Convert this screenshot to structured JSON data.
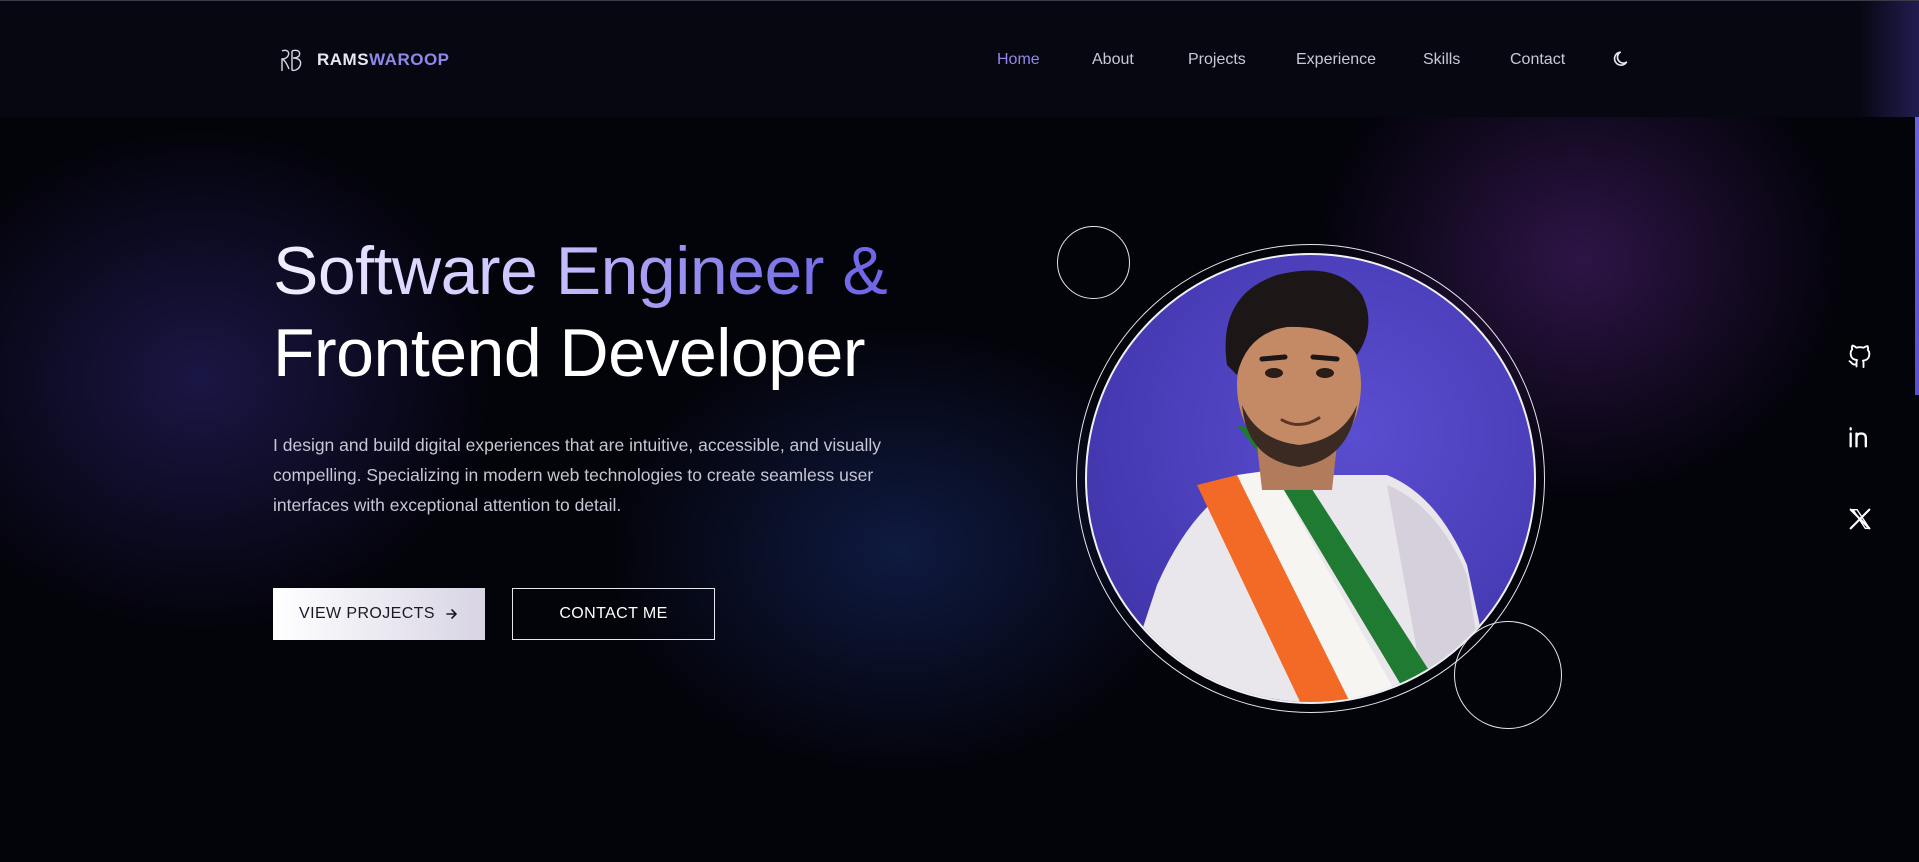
{
  "header": {
    "logo_part1": "RAMS",
    "logo_part2": "WAROOP",
    "nav": [
      {
        "label": "Home",
        "active": true
      },
      {
        "label": "About",
        "active": false
      },
      {
        "label": "Projects",
        "active": false
      },
      {
        "label": "Experience",
        "active": false
      },
      {
        "label": "Skills",
        "active": false
      },
      {
        "label": "Contact",
        "active": false
      }
    ],
    "theme_icon": "moon-icon"
  },
  "hero": {
    "title_line1": "Software Engineer &",
    "title_line2": "Frontend Developer",
    "description": "I design and build digital experiences that are intuitive, accessible, and visually compelling. Specializing in modern web technologies to create seamless user interfaces with exceptional attention to detail.",
    "primary_button": "VIEW PROJECTS",
    "primary_button_icon": "arrow-right-icon",
    "secondary_button": "CONTACT ME"
  },
  "social": [
    {
      "icon": "github-icon"
    },
    {
      "icon": "linkedin-icon"
    },
    {
      "icon": "x-twitter-icon"
    }
  ],
  "colors": {
    "accent": "#8f88ea",
    "background": "#03030a"
  }
}
